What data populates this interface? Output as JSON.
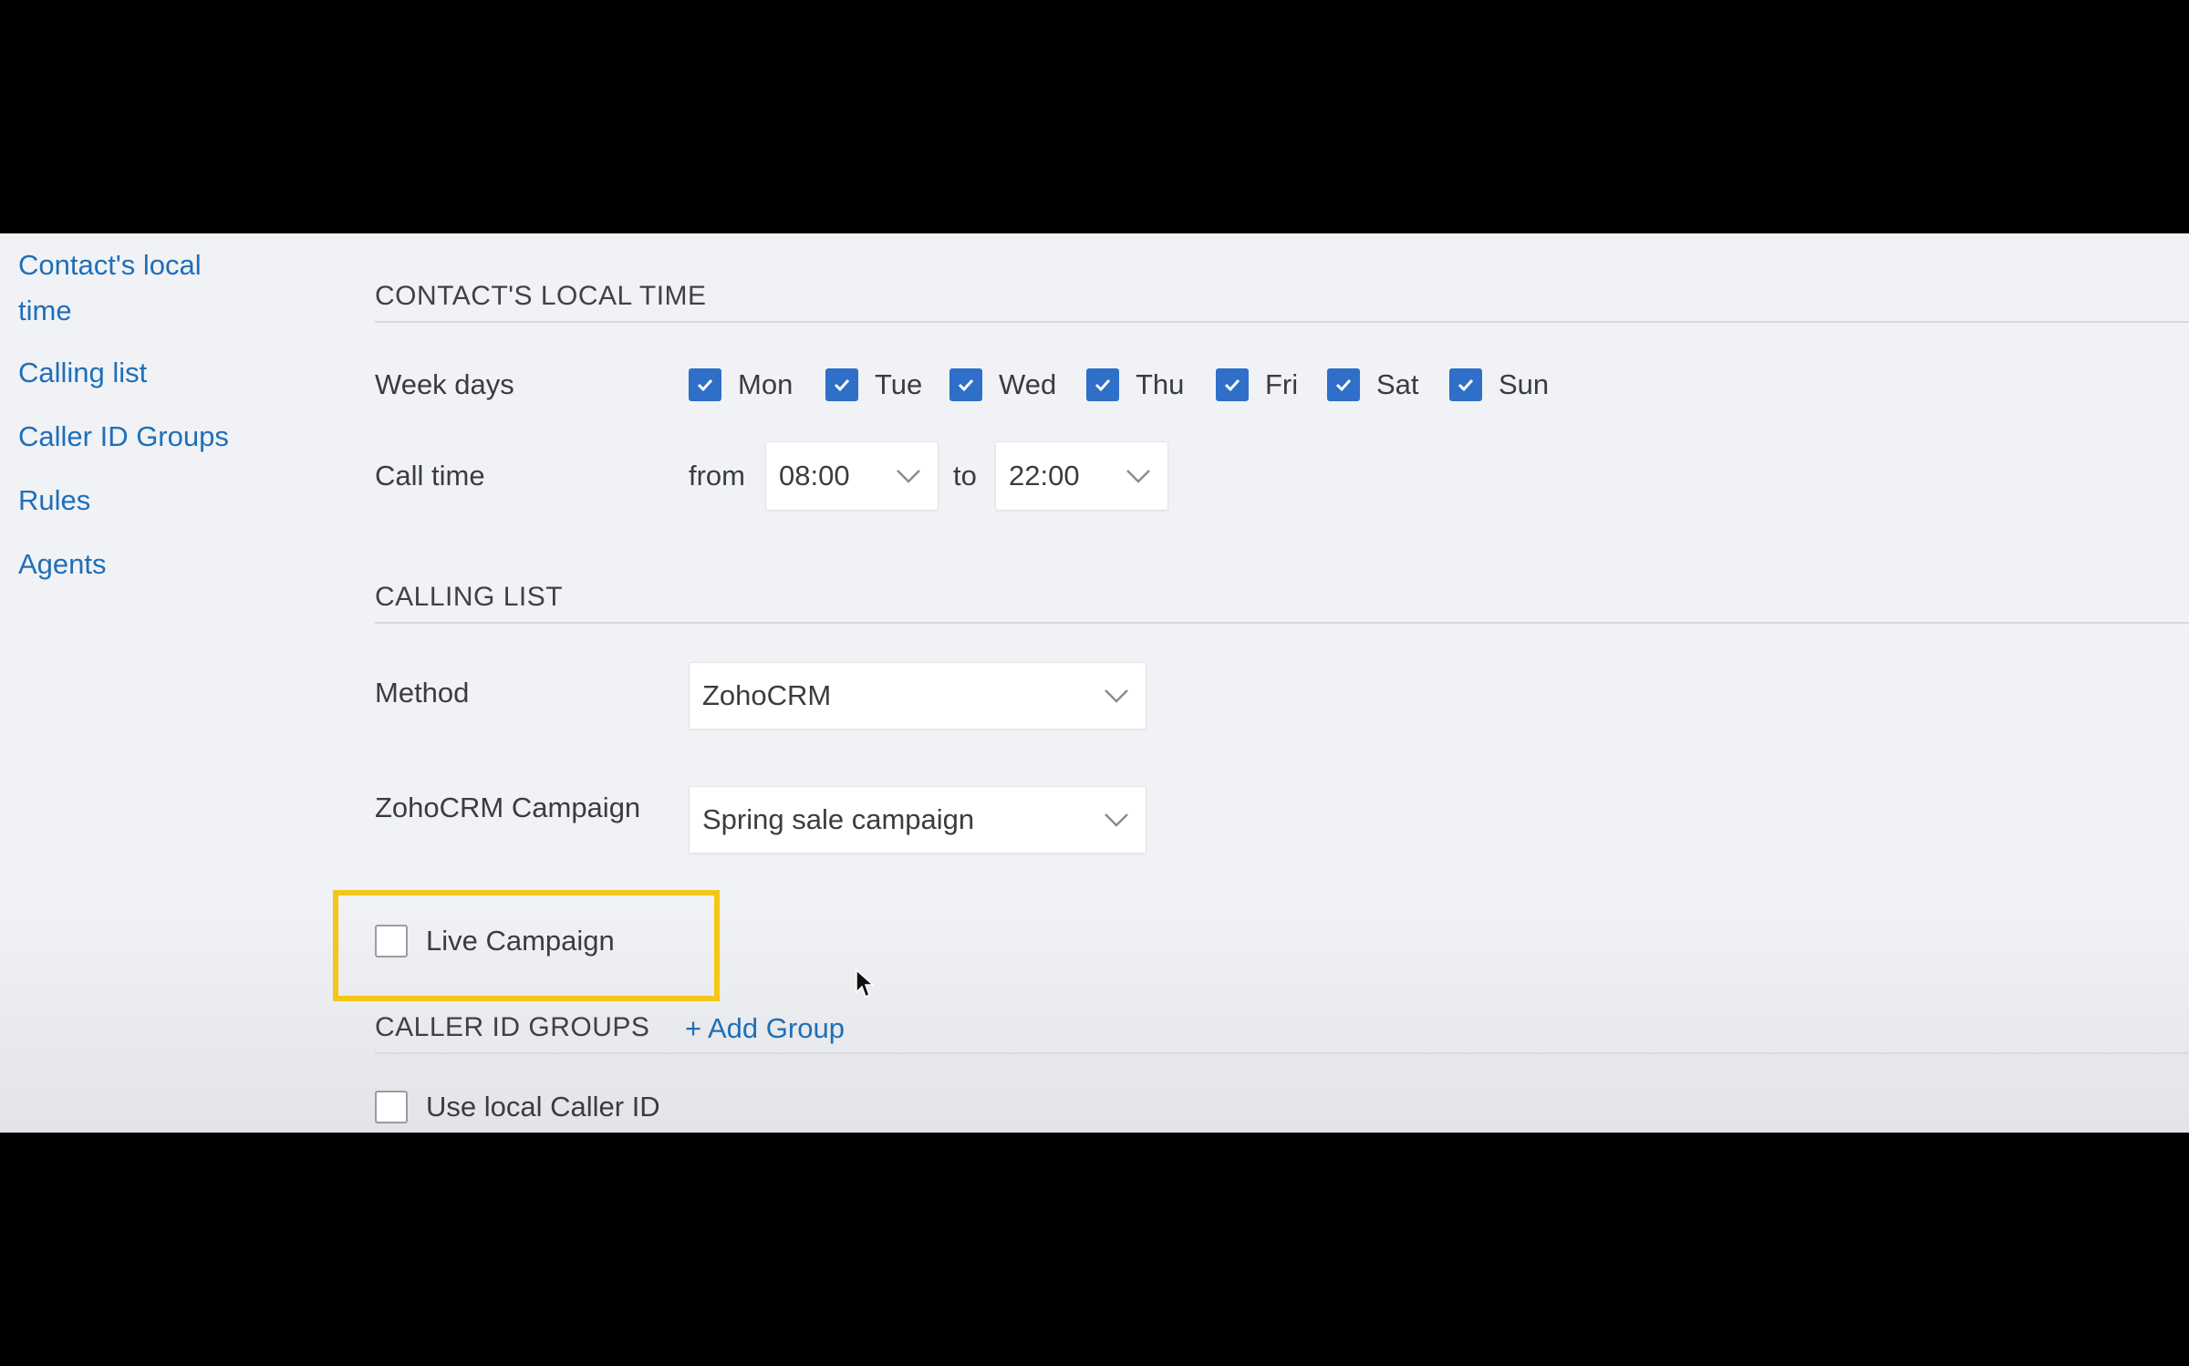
{
  "sidebar": {
    "items": [
      {
        "label": "Contact's local time"
      },
      {
        "label": "Calling list"
      },
      {
        "label": "Caller ID Groups"
      },
      {
        "label": "Rules"
      },
      {
        "label": "Agents"
      }
    ]
  },
  "contact_local_time": {
    "title": "CONTACT'S LOCAL TIME",
    "weekdays_label": "Week days",
    "days": [
      {
        "label": "Mon",
        "checked": true
      },
      {
        "label": "Tue",
        "checked": true
      },
      {
        "label": "Wed",
        "checked": true
      },
      {
        "label": "Thu",
        "checked": true
      },
      {
        "label": "Fri",
        "checked": true
      },
      {
        "label": "Sat",
        "checked": true
      },
      {
        "label": "Sun",
        "checked": true
      }
    ],
    "call_time_label": "Call time",
    "from_label": "from",
    "from_value": "08:00",
    "to_label": "to",
    "to_value": "22:00"
  },
  "calling_list": {
    "title": "CALLING LIST",
    "method_label": "Method",
    "method_value": "ZohoCRM",
    "campaign_label": "ZohoCRM Campaign",
    "campaign_value": "Spring sale campaign",
    "live_campaign_label": "Live Campaign",
    "live_campaign_checked": false
  },
  "caller_id_groups": {
    "title": "CALLER ID GROUPS",
    "add_group_label": "+ Add Group",
    "use_local_label": "Use local Caller ID",
    "use_local_checked": false
  },
  "colors": {
    "link": "#1f6fb8",
    "checkbox_checked": "#2f6fc8",
    "highlight": "#f5c518",
    "background": "#f1f2f5"
  },
  "icons": [
    "check-icon",
    "chevron-down-icon",
    "mouse-cursor-icon"
  ]
}
